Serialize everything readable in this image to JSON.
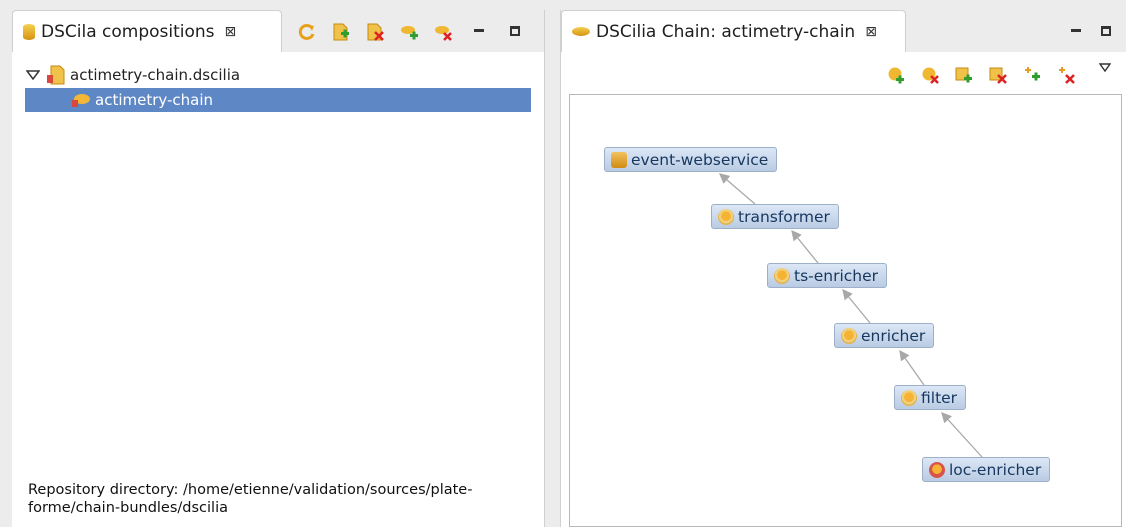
{
  "left_panel": {
    "tab_title": "DSCila compositions",
    "close_glyph": "⊠",
    "toolbar_icons": [
      "refresh-icon",
      "new-composition-icon",
      "delete-composition-icon",
      "add-chain-icon",
      "remove-chain-icon"
    ],
    "tree": {
      "root_label": "actimetry-chain.dscilia",
      "child_label": "actimetry-chain"
    },
    "footer_line1": "Repository directory: /home/etienne/validation/sources/plate-",
    "footer_line2": "forme/chain-bundles/dscilia"
  },
  "right_panel": {
    "tab_title": "DSCilia Chain: actimetry-chain",
    "close_glyph": "⊠",
    "toolbar_icons": [
      "add-node-icon",
      "remove-node-icon",
      "add-bundle-icon",
      "remove-bundle-icon",
      "add-link-icon",
      "remove-link-icon",
      "view-menu-icon"
    ],
    "nodes": [
      {
        "label": "event-webservice",
        "icon": "service-icon"
      },
      {
        "label": "transformer",
        "icon": "component-icon"
      },
      {
        "label": "ts-enricher",
        "icon": "component-icon"
      },
      {
        "label": "enricher",
        "icon": "component-icon"
      },
      {
        "label": "filter",
        "icon": "component-icon"
      },
      {
        "label": "loc-enricher",
        "icon": "source-icon"
      }
    ]
  },
  "colors": {
    "selection": "#5e87c6",
    "node_fill": "#c9d8ee",
    "node_text": "#17375e",
    "edge": "#a8a8a8"
  }
}
